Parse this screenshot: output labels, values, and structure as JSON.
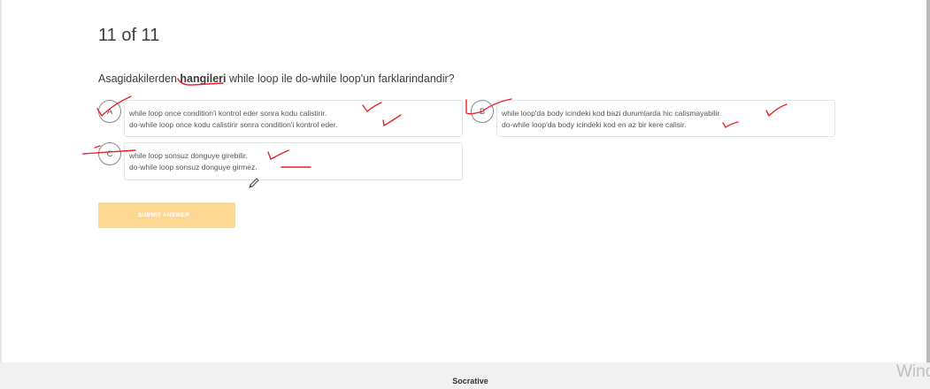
{
  "quiz": {
    "progress": "11 of 11",
    "question": {
      "prefix": "Asagidakilerden ",
      "bold": "hangileri",
      "suffix": " while loop ile do-while loop'un farklarindandir?"
    },
    "options": [
      {
        "letter": "A",
        "line1": "while loop once condition'i kontrol eder sonra kodu calistirir.",
        "line2": "do-while loop once kodu calistirir sonra condition'i kontrol eder."
      },
      {
        "letter": "B",
        "line1": "while loop'da body icindeki kod bazi durumlarda hic calismayabilir.",
        "line2": "do-while loop'da body icindeki kod en az bir kere calisir."
      },
      {
        "letter": "C",
        "line1": "while loop sonsuz donguye girebilir.",
        "line2": "do-while loop sonsuz donguye girmez."
      }
    ],
    "submit_label": "SUBMIT ANSWER"
  },
  "footer": {
    "brand": "Socrative"
  },
  "watermark": "Windows",
  "colors": {
    "submit_bg": "#fdd892",
    "annotation_ink": "#e8222a",
    "footer_bg": "#f1f1f1"
  },
  "icons": {
    "cursor": "pencil-cursor-icon"
  }
}
